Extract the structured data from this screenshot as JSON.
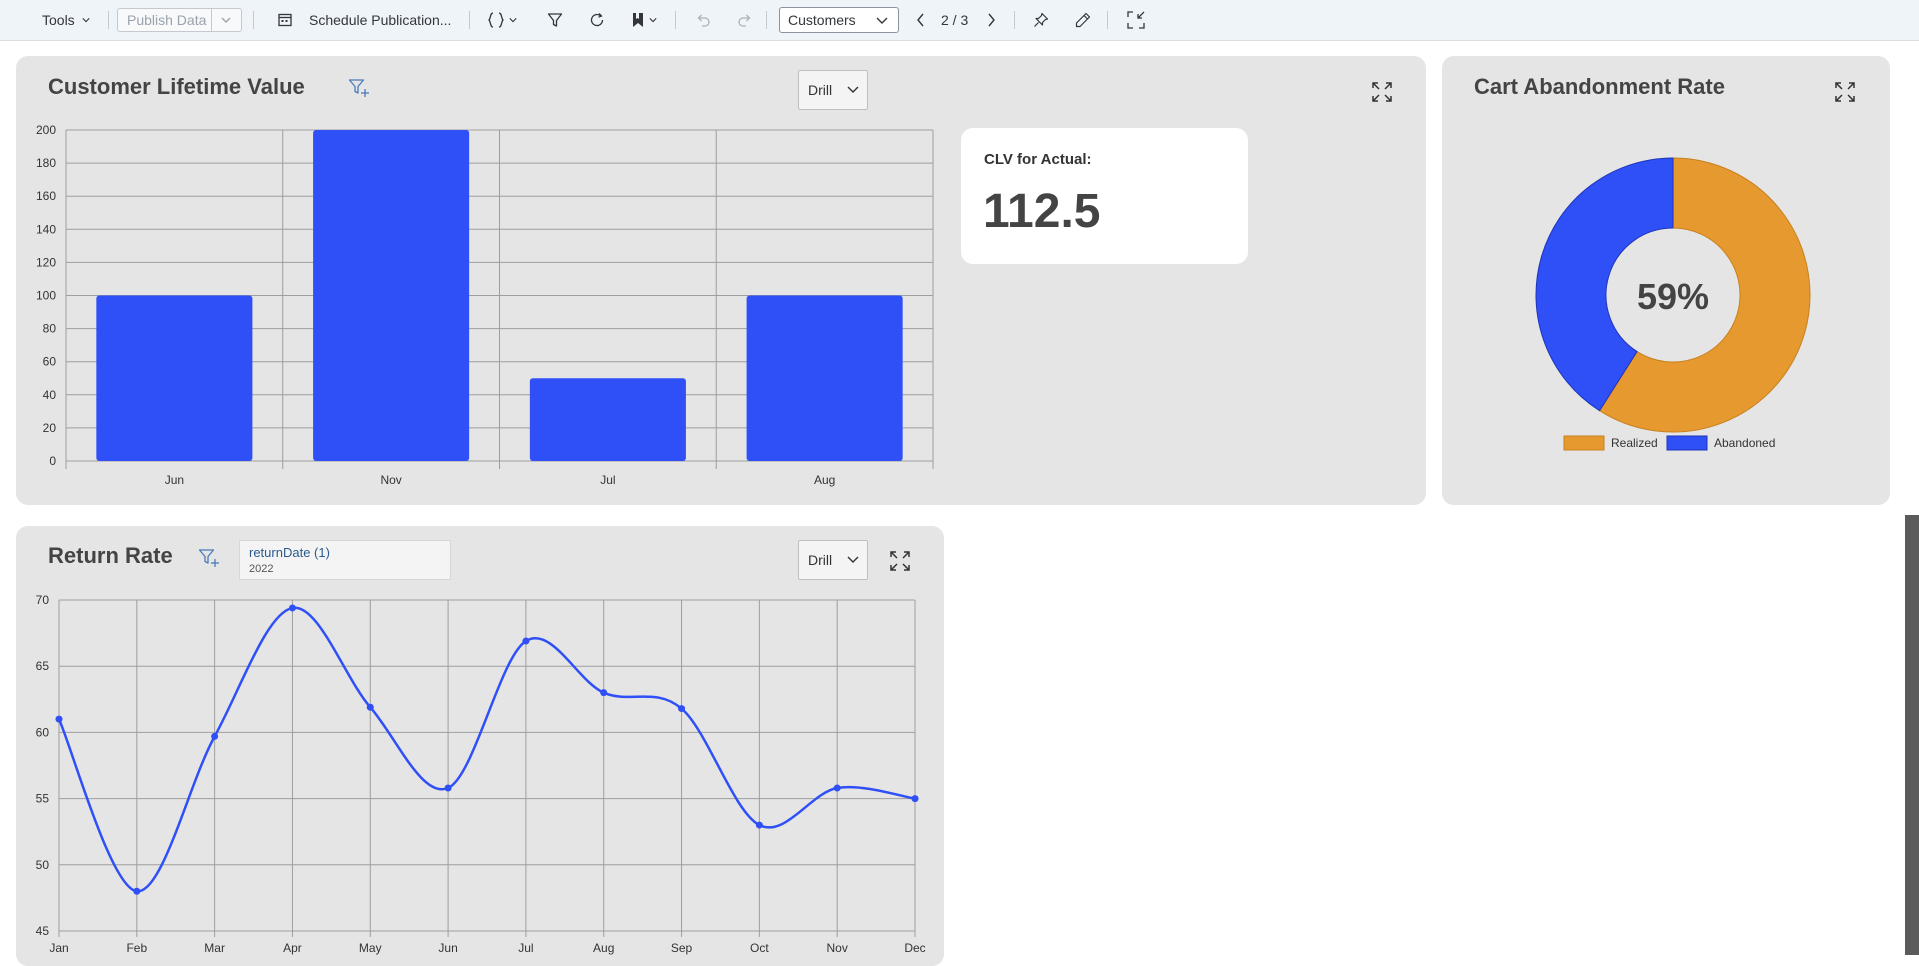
{
  "toolbar": {
    "tools_label": "Tools",
    "publish_label": "Publish Data",
    "schedule_label": "Schedule Publication...",
    "page_select_value": "Customers",
    "page_indicator": "2 / 3"
  },
  "clv": {
    "title": "Customer Lifetime Value",
    "drill_label": "Drill",
    "kpi_label": "CLV for Actual:",
    "kpi_value": "112.5"
  },
  "cart": {
    "title": "Cart Abandonment Rate",
    "center_label": "59%"
  },
  "returns": {
    "title": "Return Rate",
    "drill_label": "Drill",
    "filter_name": "returnDate (1)",
    "filter_value": "2022"
  },
  "colors": {
    "bar_blue": "#2f4ff7",
    "realized_orange": "#e6992e",
    "card_bg": "#e5e5e5"
  },
  "chart_data": [
    {
      "type": "bar",
      "categories": [
        "Jun",
        "Nov",
        "Jul",
        "Aug"
      ],
      "values": [
        100,
        200,
        50,
        100
      ],
      "ylim": [
        0,
        200
      ],
      "yticks": [
        0,
        20,
        40,
        60,
        80,
        100,
        120,
        140,
        160,
        180,
        200
      ],
      "grid": true
    },
    {
      "type": "pie",
      "labels": [
        "Realized",
        "Abandoned"
      ],
      "values": [
        59,
        41
      ],
      "colors": [
        "#e6992e",
        "#2f4ff7"
      ],
      "legend": "bottom"
    },
    {
      "type": "line",
      "x": [
        "Jan",
        "Feb",
        "Mar",
        "Apr",
        "May",
        "Jun",
        "Jul",
        "Aug",
        "Sep",
        "Oct",
        "Nov",
        "Dec"
      ],
      "values": [
        61,
        48,
        59.7,
        69.4,
        61.9,
        55.8,
        66.9,
        63,
        61.8,
        53,
        55.8,
        55
      ],
      "ylim": [
        45,
        70
      ],
      "yticks": [
        45,
        50,
        55,
        60,
        65,
        70
      ],
      "grid": true
    }
  ]
}
